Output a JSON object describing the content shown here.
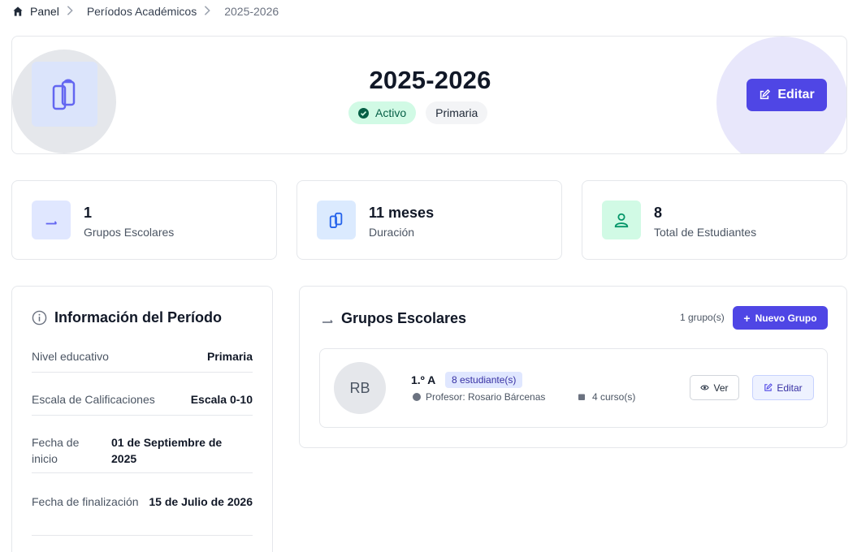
{
  "breadcrumb": {
    "home": "Panel",
    "section": "Períodos Académicos",
    "current": "2025-2026"
  },
  "header": {
    "title": "2025-2026",
    "status_badge": "Activo",
    "level_badge": "Primaria",
    "edit_label": "Editar"
  },
  "stats": [
    {
      "value": "1",
      "label": "Grupos Escolares",
      "icon": "layers-icon"
    },
    {
      "value": "11 meses",
      "label": "Duración",
      "icon": "clipboard-icon"
    },
    {
      "value": "8",
      "label": "Total de Estudiantes",
      "icon": "user-icon"
    }
  ],
  "info": {
    "title": "Información del Período",
    "rows": [
      {
        "label": "Nivel educativo",
        "value": "Primaria"
      },
      {
        "label": "Escala de Calificaciones",
        "value": "Escala 0-10"
      },
      {
        "label_line1": "Fecha de",
        "label_line2": "inicio",
        "value_line1": "01 de Septiembre de",
        "value_line2": "2025"
      },
      {
        "label": "Fecha de finalización",
        "value": "15 de Julio de 2026"
      }
    ]
  },
  "groups": {
    "title": "Grupos Escolares",
    "count_label": "1 grupo(s)",
    "new_button": "Nuevo Grupo",
    "items": [
      {
        "initials": "RB",
        "name": "1.º A",
        "students": "8 estudiante(s)",
        "teacher": "Profesor: Rosario Bárcenas",
        "courses": "4 curso(s)",
        "view_label": "Ver",
        "edit_label": "Editar"
      }
    ]
  },
  "colors": {
    "accent": "#4f46e5",
    "success_bg": "#d1fae5",
    "success_text": "#065f46"
  }
}
